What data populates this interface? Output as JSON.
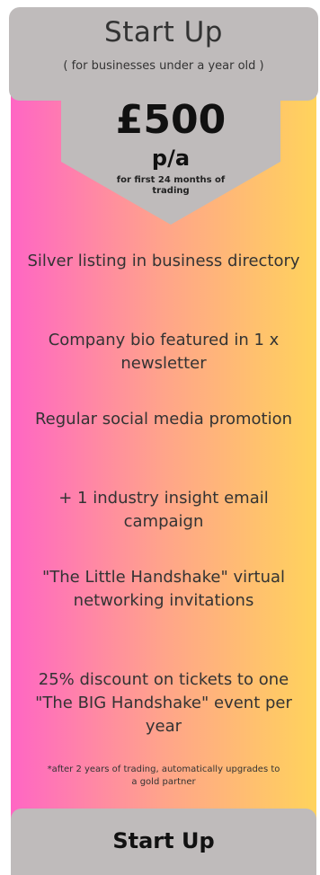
{
  "plan": {
    "title": "Start Up",
    "subtitle": "( for businesses under a year old )",
    "price": "£500",
    "period": "p/a",
    "price_note": "for first 24 months of trading",
    "features": [
      "Silver listing in business directory",
      "Company bio featured in 1 x newsletter",
      "Regular social media promotion",
      "+ 1 industry insight email campaign",
      "\"The Little Handshake\" virtual networking invitations",
      "25% discount on tickets to one  \"The BIG Handshake\" event per year"
    ],
    "footnote": "*after 2 years of trading, automatically upgrades to a gold partner",
    "button_label": "Start Up"
  },
  "colors": {
    "gradient_left": "#ff66c4",
    "gradient_right": "#ffd35c",
    "panel_gray": "#bfbbbb"
  }
}
